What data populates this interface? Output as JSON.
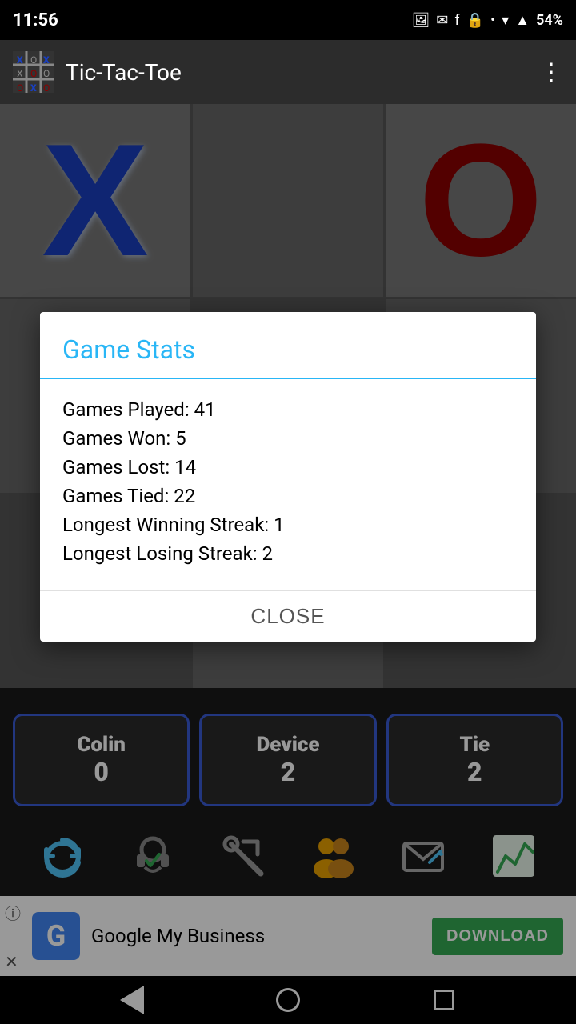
{
  "statusBar": {
    "time": "11:56",
    "battery": "54%"
  },
  "appBar": {
    "title": "Tic-Tac-Toe",
    "menuLabel": "⋮"
  },
  "dialog": {
    "title": "Game Stats",
    "stats": {
      "gamesPlayed": "Games Played: 41",
      "gamesWon": "Games Won: 5",
      "gamesLost": "Games Lost: 14",
      "gamesTied": "Games Tied: 22",
      "longestWinStreak": "Longest Winning Streak: 1",
      "longestLoseStreak": "Longest Losing Streak: 2"
    },
    "closeLabel": "Close"
  },
  "scores": [
    {
      "name": "Colin",
      "value": "0"
    },
    {
      "name": "Device",
      "value": "2"
    },
    {
      "name": "Tie",
      "value": "2"
    }
  ],
  "ad": {
    "appName": "Google My Business",
    "downloadLabel": "DOWNLOAD"
  }
}
